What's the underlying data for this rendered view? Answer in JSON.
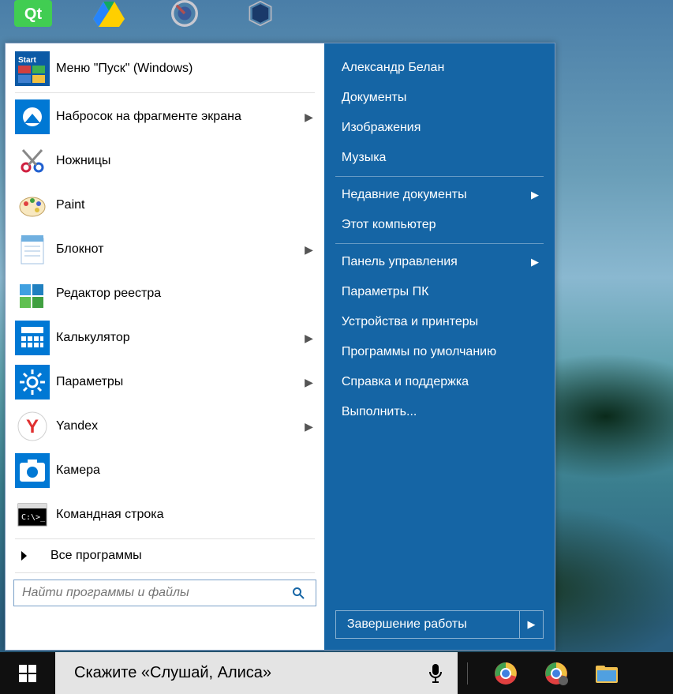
{
  "desktop_icons": [
    {
      "name": "qt-icon"
    },
    {
      "name": "google-drive-icon"
    },
    {
      "name": "krita-icon"
    },
    {
      "name": "virtualbox-icon"
    }
  ],
  "left_items": [
    {
      "id": "start-menu",
      "label": "Меню \"Пуск\" (Windows)",
      "icon": "start",
      "arrow": false,
      "sep_after": true
    },
    {
      "id": "snip",
      "label": "Набросок на фрагменте экрана",
      "icon": "snip",
      "arrow": true
    },
    {
      "id": "scissors",
      "label": "Ножницы",
      "icon": "scissors",
      "arrow": false
    },
    {
      "id": "paint",
      "label": "Paint",
      "icon": "paint",
      "arrow": false
    },
    {
      "id": "notepad",
      "label": "Блокнот",
      "icon": "notepad",
      "arrow": true
    },
    {
      "id": "regedit",
      "label": "Редактор реестра",
      "icon": "regedit",
      "arrow": false
    },
    {
      "id": "calculator",
      "label": "Калькулятор",
      "icon": "calculator",
      "arrow": true
    },
    {
      "id": "settings",
      "label": "Параметры",
      "icon": "settings",
      "arrow": true
    },
    {
      "id": "yandex",
      "label": "Yandex",
      "icon": "yandex",
      "arrow": true
    },
    {
      "id": "camera",
      "label": "Камера",
      "icon": "camera",
      "arrow": false
    },
    {
      "id": "cmd",
      "label": "Командная строка",
      "icon": "cmd",
      "arrow": false
    }
  ],
  "all_programs_label": "Все программы",
  "search_placeholder": "Найти программы и файлы",
  "right_groups": [
    [
      {
        "id": "user",
        "label": "Александр Белан",
        "arrow": false
      },
      {
        "id": "documents",
        "label": "Документы",
        "arrow": false
      },
      {
        "id": "pictures",
        "label": "Изображения",
        "arrow": false
      },
      {
        "id": "music",
        "label": "Музыка",
        "arrow": false
      }
    ],
    [
      {
        "id": "recent",
        "label": "Недавние документы",
        "arrow": true
      },
      {
        "id": "thispc",
        "label": "Этот компьютер",
        "arrow": false
      }
    ],
    [
      {
        "id": "control",
        "label": "Панель управления",
        "arrow": true
      },
      {
        "id": "pcsettings",
        "label": "Параметры ПК",
        "arrow": false
      },
      {
        "id": "devices",
        "label": "Устройства и принтеры",
        "arrow": false
      },
      {
        "id": "defaults",
        "label": "Программы по умолчанию",
        "arrow": false
      },
      {
        "id": "help",
        "label": "Справка и поддержка",
        "arrow": false
      },
      {
        "id": "run",
        "label": "Выполнить...",
        "arrow": false
      }
    ]
  ],
  "shutdown_label": "Завершение работы",
  "cortana_placeholder": "Скажите «Слушай, Алиса»",
  "taskbar_apps": [
    {
      "id": "chrome",
      "icon": "chrome"
    },
    {
      "id": "chrome-canary",
      "icon": "chrome-alt"
    },
    {
      "id": "explorer",
      "icon": "explorer"
    }
  ]
}
